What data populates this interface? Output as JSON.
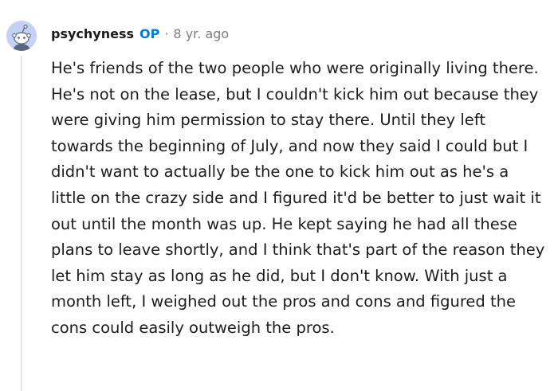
{
  "comment": {
    "avatar_icon": "reddit-default-avatar-icon",
    "username": "psychyness",
    "op_badge": "OP",
    "separator": "·",
    "timestamp": "8 yr. ago",
    "body": "He's friends of the two people who were originally living there. He's not on the lease, but I couldn't kick him out because they were giving him permission to stay there. Until they left towards the beginning of July, and now they said I could but I didn't want to actually be the one to kick him out as he's a little on the crazy side and I figured it'd be better to just wait it out until the month was up. He kept saying he had all these plans to leave shortly, and I think that's part of the reason they let him stay as long as he did, but I don't know. With just a month left, I weighed out the pros and cons and figured the cons could easily outweigh the pros."
  },
  "colors": {
    "op_badge": "#0079d3",
    "avatar_bg": "#c5d0f5",
    "meta_gray": "#7c7c7c",
    "text": "#1c1c1c"
  }
}
